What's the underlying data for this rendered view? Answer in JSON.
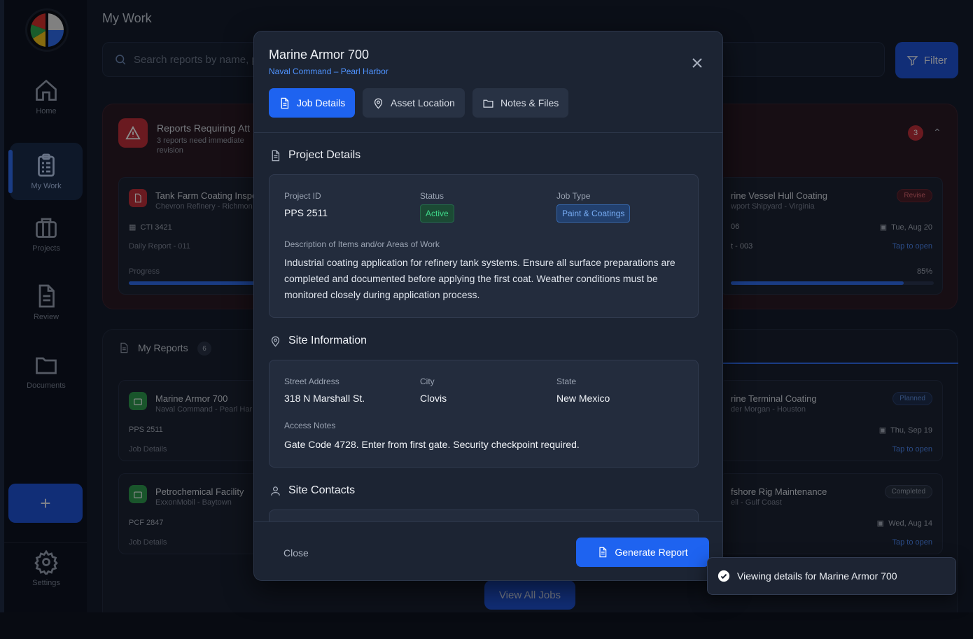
{
  "page_title": "My Work",
  "search": {
    "placeholder": "Search reports by name, pr"
  },
  "filter_label": "Filter",
  "nav": [
    {
      "label": "Home",
      "icon": "home-icon"
    },
    {
      "label": "My Work",
      "icon": "clipboard-icon",
      "active": true
    },
    {
      "label": "Projects",
      "icon": "briefcase-icon"
    },
    {
      "label": "Review",
      "icon": "document-icon"
    },
    {
      "label": "Documents",
      "icon": "folder-icon"
    },
    {
      "label": "Settings",
      "icon": "gear-icon"
    }
  ],
  "fab_label": "+",
  "attention": {
    "title": "Reports Requiring Att",
    "subtitle": "3 reports need immediate revision",
    "count": "3",
    "card_left": {
      "title": "Tank Farm Coating Inspe",
      "subtitle": "Chevron Refinery - Richmon",
      "id": "CTI 3421",
      "meta": "Daily Report - 011",
      "progress_label": "Progress",
      "progress": 0.85
    },
    "card_right": {
      "title": "rine Vessel Hull Coating",
      "subtitle": "wport Shipyard - Virginia",
      "badge": "Revise",
      "id": "06",
      "meta": "t - 003",
      "date": "Tue, Aug 20",
      "open": "Tap to open",
      "percent": "85%",
      "progress": 0.85
    }
  },
  "reports": {
    "title": "My Reports",
    "count": "6",
    "left_cards": [
      {
        "title": "Marine Armor 700",
        "subtitle": "Naval Command - Pearl Har",
        "id": "PPS 2511",
        "meta": "Job Details"
      },
      {
        "title": "Petrochemical Facility",
        "subtitle": "ExxonMobil - Baytown",
        "id": "PCF 2847",
        "meta": "Job Details"
      }
    ],
    "right_cards": [
      {
        "title": "rine Terminal Coating",
        "subtitle": "der Morgan - Houston",
        "badge": "Planned",
        "date": "Thu, Sep 19",
        "open": "Tap to open"
      },
      {
        "title": "fshore Rig Maintenance",
        "subtitle": "ell - Gulf Coast",
        "badge": "Completed",
        "date": "Wed, Aug 14",
        "open": "Tap to open"
      }
    ],
    "view_all": "View All Jobs"
  },
  "modal": {
    "title": "Marine Armor 700",
    "subtitle": "Naval Command – Pearl Harbor",
    "tabs": [
      {
        "label": "Job Details",
        "icon": "document-icon",
        "active": true
      },
      {
        "label": "Asset Location",
        "icon": "map-pin-icon"
      },
      {
        "label": "Notes & Files",
        "icon": "folder-icon"
      }
    ],
    "project": {
      "heading": "Project Details",
      "id_label": "Project ID",
      "id_value": "PPS 2511",
      "status_label": "Status",
      "status_value": "Active",
      "type_label": "Job Type",
      "type_value": "Paint & Coatings",
      "desc_label": "Description of Items and/or Areas of Work",
      "desc_value": "Industrial coating application for refinery tank systems. Ensure all surface preparations are completed and documented before applying the first coat. Weather conditions must be monitored closely during application process."
    },
    "site": {
      "heading": "Site Information",
      "street_label": "Street Address",
      "street_value": "318 N Marshall St.",
      "city_label": "City",
      "city_value": "Clovis",
      "state_label": "State",
      "state_value": "New Mexico",
      "notes_label": "Access Notes",
      "notes_value": "Gate Code 4728. Enter from first gate. Security checkpoint required."
    },
    "contacts": {
      "heading": "Site Contacts"
    },
    "footer": {
      "close": "Close",
      "generate": "Generate Report"
    }
  },
  "toast": {
    "message": "Viewing details for Marine Armor 700"
  },
  "colors": {
    "accent": "#1e63f0",
    "danger": "#c0303a",
    "success": "#3fd98a"
  }
}
